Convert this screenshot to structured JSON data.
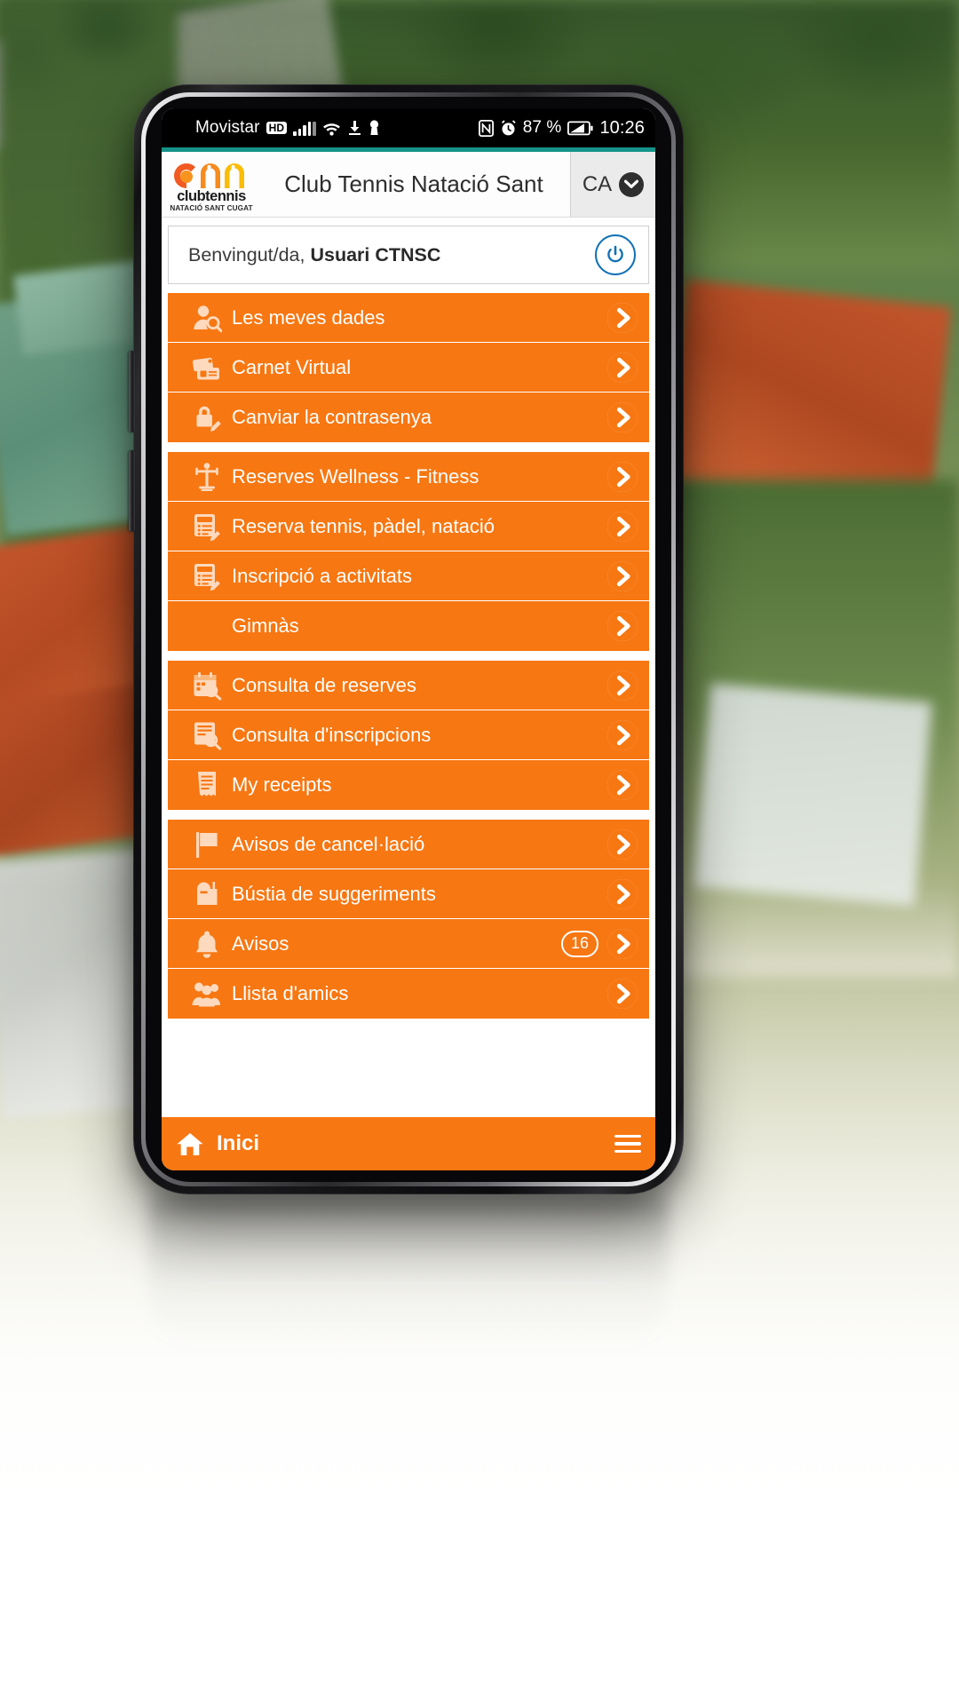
{
  "status_bar": {
    "carrier": "Movistar",
    "network_badge": "HD",
    "icons": [
      "signal-bars-icon",
      "wifi-icon",
      "download-icon",
      "vpn-key-icon",
      "nfc-icon",
      "alarm-icon"
    ],
    "battery_percent": "87 %",
    "time": "10:26"
  },
  "header": {
    "logo_word_1": "club",
    "logo_word_2": "tennis",
    "logo_subline": "NATACIÓ SANT CUGAT",
    "title": "Club Tennis Natació Sant",
    "language_code": "CA"
  },
  "welcome": {
    "greeting": "Benvingut/da,",
    "user_name": "Usuari CTNSC",
    "logout_icon": "power-icon"
  },
  "menu_groups": [
    {
      "items": [
        {
          "label": "Les meves dades",
          "icon": "user-search-icon",
          "badge": null
        },
        {
          "label": "Carnet Virtual",
          "icon": "id-card-icon",
          "badge": null
        },
        {
          "label": "Canviar la contrasenya",
          "icon": "lock-edit-icon",
          "badge": null
        }
      ]
    },
    {
      "items": [
        {
          "label": "Reserves Wellness - Fitness",
          "icon": "fitness-person-icon",
          "badge": null
        },
        {
          "label": "Reserva tennis, pàdel, natació",
          "icon": "list-edit-icon",
          "badge": null
        },
        {
          "label": "Inscripció a activitats",
          "icon": "list-edit-icon",
          "badge": null
        },
        {
          "label": "Gimnàs",
          "icon": "none",
          "badge": null
        }
      ]
    },
    {
      "items": [
        {
          "label": "Consulta de reserves",
          "icon": "calendar-search-icon",
          "badge": null
        },
        {
          "label": "Consulta d'inscripcions",
          "icon": "document-search-icon",
          "badge": null
        },
        {
          "label": "My receipts",
          "icon": "receipt-icon",
          "badge": null
        }
      ]
    },
    {
      "items": [
        {
          "label": "Avisos de cancel·lació",
          "icon": "flag-icon",
          "badge": null
        },
        {
          "label": "Bústia de suggeriments",
          "icon": "mailbox-icon",
          "badge": null
        },
        {
          "label": "Avisos",
          "icon": "bell-icon",
          "badge": "16"
        },
        {
          "label": "Llista d'amics",
          "icon": "people-group-icon",
          "badge": null
        }
      ]
    }
  ],
  "footer": {
    "home_label": "Inici",
    "home_icon": "home-icon",
    "menu_icon": "hamburger-menu-icon"
  },
  "colors": {
    "accent_orange": "#f77712",
    "teal_line": "#159389",
    "logo_orange": "#f4791f",
    "logo_yellow": "#fbbc05",
    "logo_red_orange": "#f15a22"
  }
}
